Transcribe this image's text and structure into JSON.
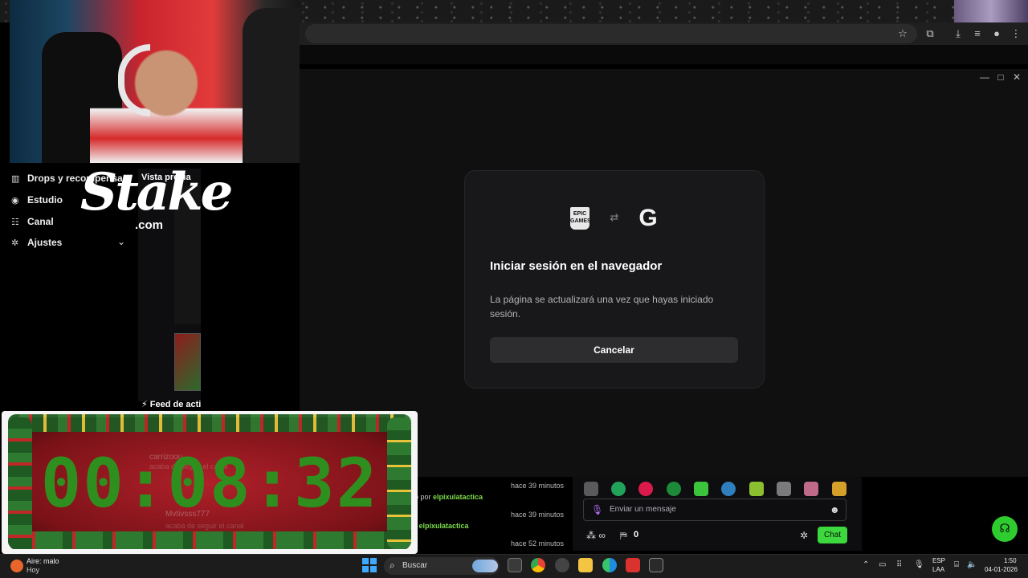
{
  "sidebar": {
    "items": [
      {
        "label": "Drops y recompensas",
        "icon": "drops-icon"
      },
      {
        "label": "Estudio",
        "icon": "studio-icon"
      },
      {
        "label": "Canal",
        "icon": "channel-icon"
      },
      {
        "label": "Ajustes",
        "icon": "gear-icon"
      }
    ]
  },
  "overlay": {
    "logo_text": "Stake",
    "logo_domain": ".com",
    "timer": "00:08:32"
  },
  "preview": {
    "title": "Vista previa",
    "feed_title": "Feed de acti"
  },
  "dialog": {
    "title": "Iniciar sesión en el navegador",
    "description": "La página se actualizará una vez que hayas iniciado sesión.",
    "cancel_label": "Cancelar",
    "epic_label": "EPIC GAMES"
  },
  "feed": {
    "items": [
      {
        "prefix": "o por",
        "user": "elpixulatactica",
        "time": "hace 39 minutos"
      },
      {
        "prefix": "r",
        "user": "elpixulatactica",
        "time": "hace 39 minutos"
      },
      {
        "prefix": "",
        "user": "",
        "time": "hace 52 minutos"
      }
    ],
    "behind_timer": [
      {
        "user": "carrizoou",
        "text": "acaba de seguir el canal"
      },
      {
        "user": "Mvtivsss777",
        "text": "acaba de seguir el canal"
      }
    ]
  },
  "chat": {
    "placeholder": "Enviar un mensaje",
    "gift_count": "0",
    "chat_button": "Chat"
  },
  "taskbar": {
    "weather_line1": "Aire: malo",
    "weather_line2": "Hoy",
    "search_label": "Buscar",
    "lang_1": "ESP",
    "lang_2": "LAA",
    "time": "1:50",
    "date": "04-01-2026"
  }
}
